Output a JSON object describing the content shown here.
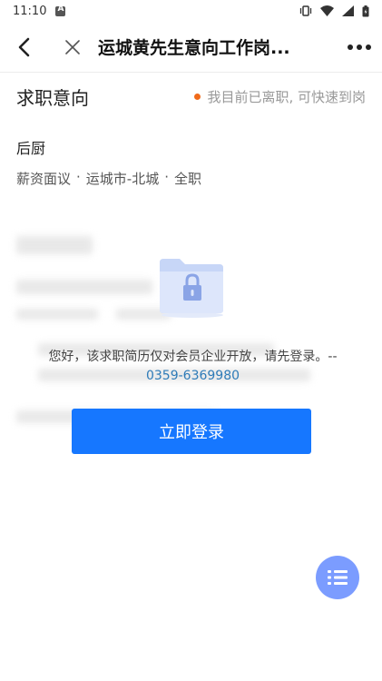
{
  "status_bar": {
    "time": "11:10"
  },
  "nav": {
    "title": "运城黄先生意向工作岗..."
  },
  "intention": {
    "section_title": "求职意向",
    "status_note": "我目前已离职, 可快速到岗",
    "status_dot_color": "#f06a1a",
    "job_title": "后厨",
    "salary": "薪资面议",
    "location": "运城市-北城",
    "job_type": "全职",
    "separator": "·"
  },
  "lock_overlay": {
    "message": "您好，该求职简历仅对会员企业开放，请先登录。--",
    "phone": "0359-6369980",
    "login_button": "立即登录",
    "button_color": "#1677ff"
  },
  "icons": {
    "back": "chevron-left-icon",
    "close": "close-icon",
    "more": "more-dots-icon",
    "lock": "lock-folder-icon",
    "list": "list-icon"
  }
}
